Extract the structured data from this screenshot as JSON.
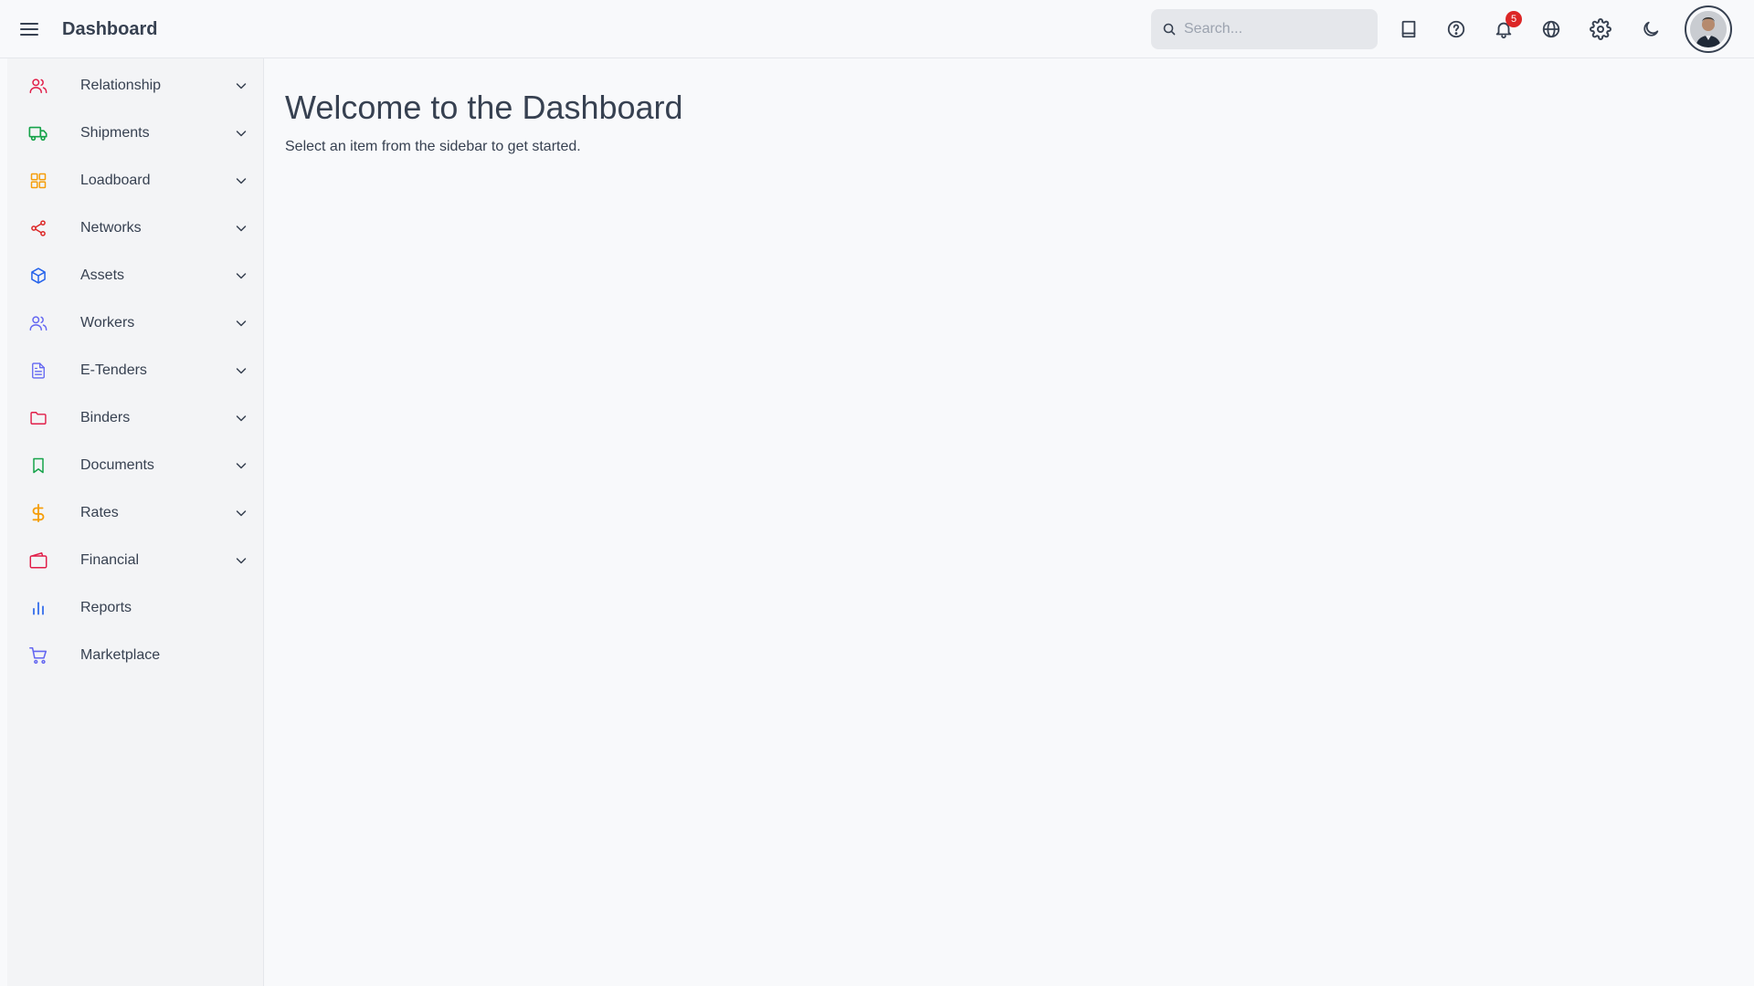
{
  "header": {
    "title": "Dashboard",
    "menu_icon": "hamburger-menu-icon",
    "search": {
      "placeholder": "Search...",
      "value": ""
    },
    "icons": [
      "book-icon",
      "help-icon",
      "bell-icon",
      "globe-icon",
      "gear-icon",
      "moon-icon"
    ],
    "notification_count": "5",
    "badge_color": "#dc2626"
  },
  "sidebar": {
    "items": [
      {
        "label": "Relationship",
        "icon": "users-icon",
        "color": "#e11d48",
        "expandable": true
      },
      {
        "label": "Shipments",
        "icon": "truck-icon",
        "color": "#16a34a",
        "expandable": true
      },
      {
        "label": "Loadboard",
        "icon": "grid-icon",
        "color": "#f59e0b",
        "expandable": true
      },
      {
        "label": "Networks",
        "icon": "share-icon",
        "color": "#dc2626",
        "expandable": true
      },
      {
        "label": "Assets",
        "icon": "box-icon",
        "color": "#2563eb",
        "expandable": true
      },
      {
        "label": "Workers",
        "icon": "users-icon",
        "color": "#6366f1",
        "expandable": true
      },
      {
        "label": "E-Tenders",
        "icon": "file-text-icon",
        "color": "#6366f1",
        "expandable": true
      },
      {
        "label": "Binders",
        "icon": "folder-icon",
        "color": "#e11d48",
        "expandable": true
      },
      {
        "label": "Documents",
        "icon": "bookmark-icon",
        "color": "#16a34a",
        "expandable": true
      },
      {
        "label": "Rates",
        "icon": "dollar-icon",
        "color": "#f59e0b",
        "expandable": true
      },
      {
        "label": "Financial",
        "icon": "wallet-icon",
        "color": "#e11d48",
        "expandable": true
      },
      {
        "label": "Reports",
        "icon": "bar-chart-icon",
        "color": "#2563eb",
        "expandable": false
      },
      {
        "label": "Marketplace",
        "icon": "cart-icon",
        "color": "#6366f1",
        "expandable": false
      }
    ]
  },
  "main": {
    "title": "Welcome to the Dashboard",
    "subtitle": "Select an item from the sidebar to get started."
  }
}
